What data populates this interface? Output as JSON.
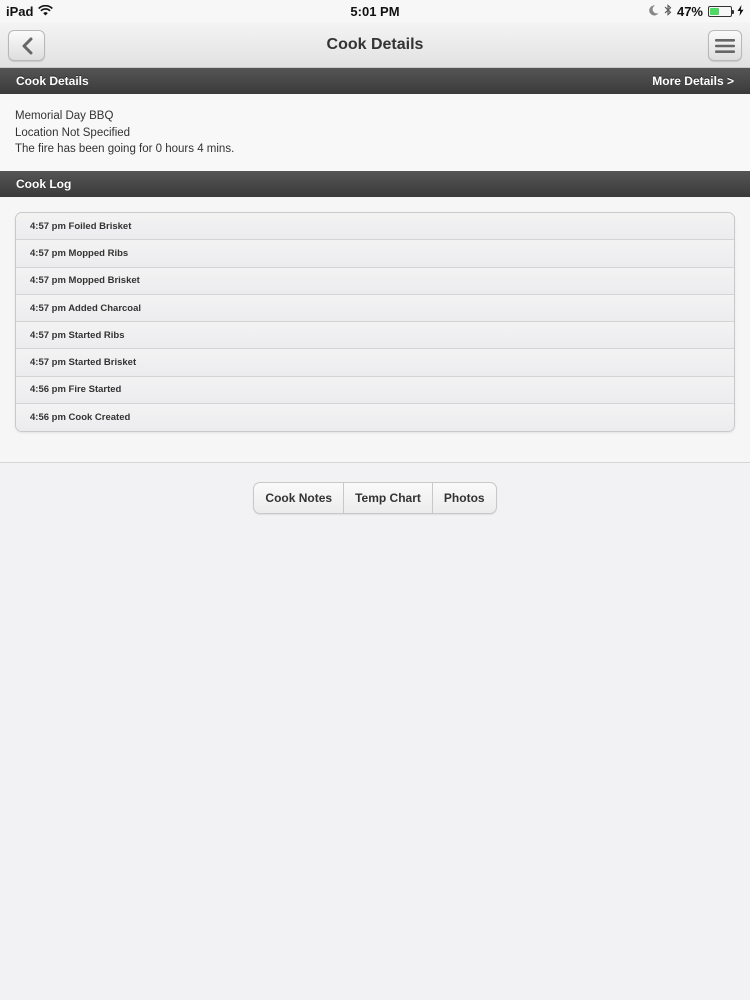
{
  "status_bar": {
    "device": "iPad",
    "time": "5:01 PM",
    "battery_percent": "47%",
    "battery_level": 0.47
  },
  "nav": {
    "title": "Cook Details"
  },
  "details_section": {
    "header": "Cook Details",
    "more_link": "More Details >",
    "name": "Memorial Day BBQ",
    "location": "Location Not Specified",
    "fire_status": "The fire has been going for 0 hours 4 mins."
  },
  "log_section": {
    "header": "Cook Log",
    "entries": [
      "4:57 pm Foiled Brisket",
      "4:57 pm Mopped Ribs",
      "4:57 pm Mopped Brisket",
      "4:57 pm Added Charcoal",
      "4:57 pm Started Ribs",
      "4:57 pm Started Brisket",
      "4:56 pm Fire Started",
      "4:56 pm Cook Created"
    ]
  },
  "tabs": {
    "items": [
      "Cook Notes",
      "Temp Chart",
      "Photos"
    ]
  },
  "colors": {
    "section_header_bg": "#3f3f3f",
    "page_bg": "#f2f1f4",
    "battery_green": "#4cd964"
  }
}
